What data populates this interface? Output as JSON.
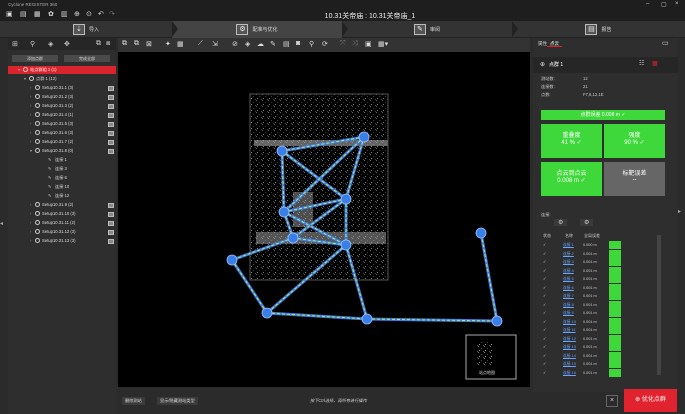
{
  "app": {
    "title": "Cyclone REGISTER 360",
    "doc_title": "10.31关帝庙 : 10.31关帝庙_1"
  },
  "steps": [
    {
      "label": "导入",
      "icon": "import-icon"
    },
    {
      "label": "配准与优化",
      "icon": "register-icon"
    },
    {
      "label": "审阅",
      "icon": "review-icon"
    },
    {
      "label": "报告",
      "icon": "report-icon"
    }
  ],
  "left": {
    "add_label": "添加点群",
    "remove_label": "完成全部",
    "tree": [
      {
        "label": "站点群组 1 (1)",
        "level": 0,
        "type": "group",
        "selected": true
      },
      {
        "label": "点群 1 (12)",
        "level": 1,
        "type": "bundle"
      },
      {
        "label": "Setup10.31.1 (3)",
        "level": 2,
        "type": "setup"
      },
      {
        "label": "Setup10.31.2 (3)",
        "level": 2,
        "type": "setup"
      },
      {
        "label": "Setup10.31.3 (2)",
        "level": 2,
        "type": "setup"
      },
      {
        "label": "Setup10.31.4 (1)",
        "level": 2,
        "type": "setup"
      },
      {
        "label": "Setup10.31.5 (3)",
        "level": 2,
        "type": "setup"
      },
      {
        "label": "Setup10.31.6 (3)",
        "level": 2,
        "type": "setup"
      },
      {
        "label": "Setup10.31.7 (2)",
        "level": 2,
        "type": "setup"
      },
      {
        "label": "Setup10.31.8 (0)",
        "level": 2,
        "type": "setup-open"
      },
      {
        "label": "连接 1",
        "level": 3,
        "type": "link"
      },
      {
        "label": "连接 3",
        "level": 3,
        "type": "link"
      },
      {
        "label": "连接 6",
        "level": 3,
        "type": "link"
      },
      {
        "label": "连接 10",
        "level": 3,
        "type": "link"
      },
      {
        "label": "连接 12",
        "level": 3,
        "type": "link"
      },
      {
        "label": "Setup10.31.9 (2)",
        "level": 2,
        "type": "setup"
      },
      {
        "label": "Setup10.31.10 (3)",
        "level": 2,
        "type": "setup"
      },
      {
        "label": "Setup10.31.11 (2)",
        "level": 2,
        "type": "setup"
      },
      {
        "label": "Setup10.31.12 (3)",
        "level": 2,
        "type": "setup"
      },
      {
        "label": "Setup10.31.13 (3)",
        "level": 2,
        "type": "setup"
      }
    ]
  },
  "viewport": {
    "minimap_label": "站点地图"
  },
  "bottom": {
    "btn1": "删除测站",
    "btn2": "显示/隐藏测站类型",
    "hint": "按下Ctrl选择，再所有进行操作"
  },
  "right": {
    "tab1": "属性",
    "tab2": "点云",
    "bundle_name": "点群 1",
    "kv": [
      {
        "k": "测站数:",
        "v": "12"
      },
      {
        "k": "连接数:",
        "v": "21"
      },
      {
        "k": "点数:",
        "v": "F7,6,12,1E"
      }
    ],
    "cloud_error": "点群误差 0.008 m",
    "overlap_label": "重叠度",
    "overlap_value": "41 %",
    "strength_label": "强度",
    "strength_value": "90 %",
    "c2c_label": "点云到点云",
    "c2c_value": "0.008 m",
    "target_label": "标靶误差",
    "target_value": "--",
    "links_label": "连接:",
    "cols": [
      "状态",
      "名称",
      "全局误差"
    ],
    "rows": [
      {
        "name": "连接 1",
        "err": "0.000 m"
      },
      {
        "name": "连接 2",
        "err": "0.001 m"
      },
      {
        "name": "连接 3",
        "err": "0.001 m"
      },
      {
        "name": "连接 4",
        "err": "0.001 m"
      },
      {
        "name": "连接 5",
        "err": "0.001 m"
      },
      {
        "name": "连接 6",
        "err": "0.001 m"
      },
      {
        "name": "连接 7",
        "err": "0.001 m"
      },
      {
        "name": "连接 8",
        "err": "0.001 m"
      },
      {
        "name": "连接 9",
        "err": "0.001 m"
      },
      {
        "name": "连接 10",
        "err": "0.001 m"
      },
      {
        "name": "连接 11",
        "err": "0.001 m"
      },
      {
        "name": "连接 12",
        "err": "0.001 m"
      },
      {
        "name": "连接 13",
        "err": "0.001 m"
      },
      {
        "name": "连接 14",
        "err": "0.001 m"
      },
      {
        "name": "连接 15",
        "err": "0.001 m"
      },
      {
        "name": "连接 16",
        "err": "0.001 m"
      }
    ],
    "optimize_label": "优化点群"
  },
  "colors": {
    "accent": "#d9232d",
    "green": "#3fd83a",
    "node": "#3a7ee8"
  }
}
